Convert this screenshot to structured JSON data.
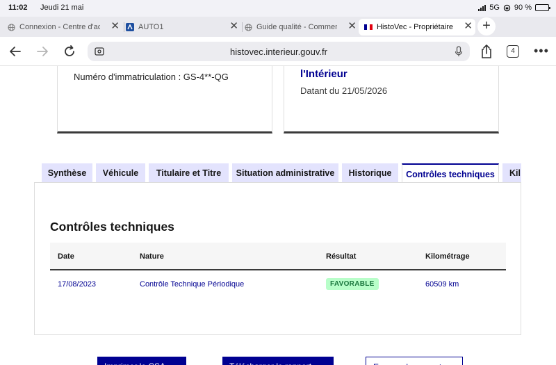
{
  "status_bar": {
    "time": "11:02",
    "date": "Jeudi 21 mai",
    "network": "5G",
    "battery": "90 %"
  },
  "browser_tabs": [
    {
      "title": "Connexion - Centre d'ac",
      "active": false
    },
    {
      "title": "AUTO1",
      "active": false
    },
    {
      "title": "Guide qualité - Commen",
      "active": false
    },
    {
      "title": "HistoVec - Propriétaire",
      "active": true
    }
  ],
  "address_bar": {
    "url": "histovec.interieur.gouv.fr",
    "tab_count": "4"
  },
  "top_cards": {
    "registration": "Numéro d'immatriculation : GS-4**-QG",
    "org_title": "l'Intérieur",
    "dated": "Datant du 21/05/2026"
  },
  "page_tabs": [
    {
      "label": "Synthèse"
    },
    {
      "label": "Véhicule"
    },
    {
      "label": "Titulaire et Titre"
    },
    {
      "label": "Situation administrative"
    },
    {
      "label": "Historique"
    },
    {
      "label": "Contrôles techniques"
    },
    {
      "label": "Kil"
    }
  ],
  "controls": {
    "heading": "Contrôles techniques",
    "columns": [
      "Date",
      "Nature",
      "Résultat",
      "Kilométrage"
    ],
    "rows": [
      {
        "date": "17/08/2023",
        "nature": "Contrôle Technique Périodique",
        "result": "FAVORABLE",
        "mileage": "60509 km"
      }
    ]
  },
  "bottom_buttons": [
    "Imprimer le CSA",
    "Télécharger le rapport",
    "Envoyer le rapport"
  ],
  "colors": {
    "accent": "#000091",
    "tab_bg": "#e3e3fd",
    "badge_bg": "#b8fec9",
    "badge_text": "#18753c"
  }
}
